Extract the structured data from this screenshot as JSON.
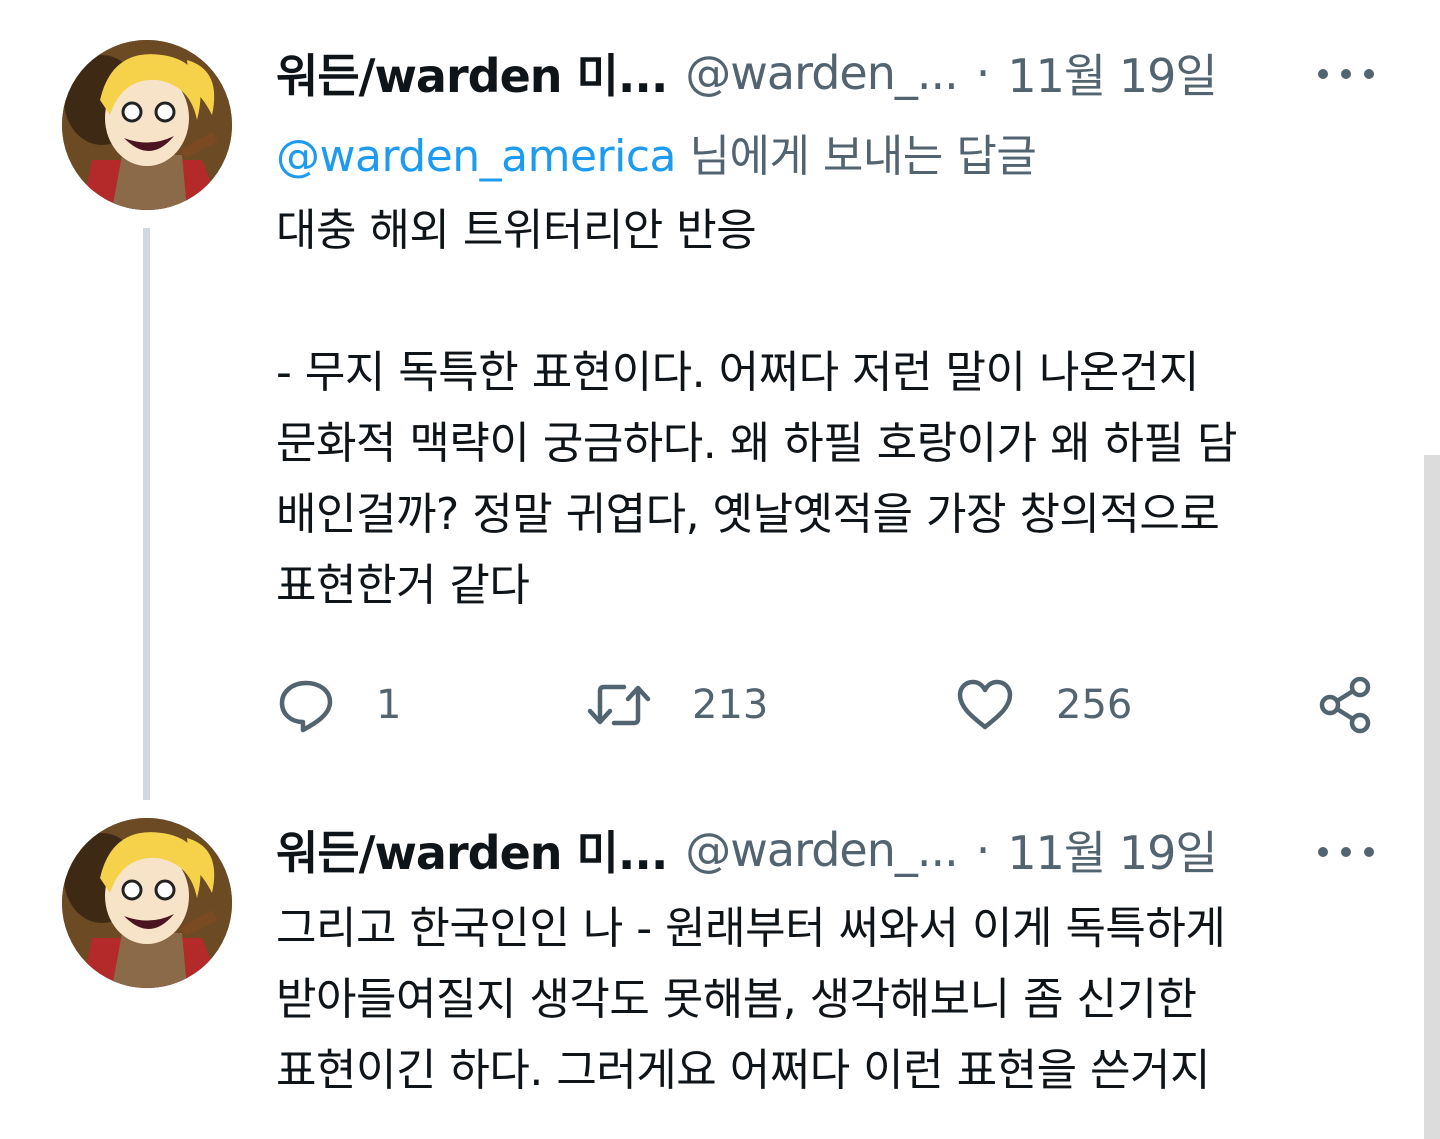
{
  "tweets": [
    {
      "author_name": "워든/warden 미...",
      "handle": "@warden_...",
      "separator": "·",
      "time": "11월 19일",
      "reply_to": {
        "mention": "@warden_america",
        "suffix": " 님에게 보내는 답글"
      },
      "text": "대충 해외 트위터리안  반응\n\n- 무지 독특한 표현이다. 어쩌다 저런 말이 나온건지\n문화적 맥략이 궁금하다. 왜 하필 호랑이가 왜 하필 담\n배인걸까? 정말 귀엽다, 옛날옛적을 가장 창의적으로\n표현한거 같다",
      "reply_count": "1",
      "retweet_count": "213",
      "like_count": "256"
    },
    {
      "author_name": "워든/warden 미...",
      "handle": "@warden_...",
      "separator": "·",
      "time": "11월 19일",
      "text": "그리고 한국인인 나 - 원래부터 써와서 이게 독특하게\n받아들여질지 생각도 못해봄, 생각해보니 좀 신기한\n표현이긴 하다. 그러게요 어쩌다 이런 표현을 쓴거지"
    }
  ],
  "icons": {
    "more": "more-horizontal-icon",
    "reply": "reply-bubble-icon",
    "retweet": "retweet-icon",
    "like": "heart-icon",
    "share": "share-icon"
  },
  "colors": {
    "link": "#1d9bf0",
    "secondary_text": "#536471",
    "primary_text": "#0f1419",
    "thread_line": "#cfd9de"
  }
}
